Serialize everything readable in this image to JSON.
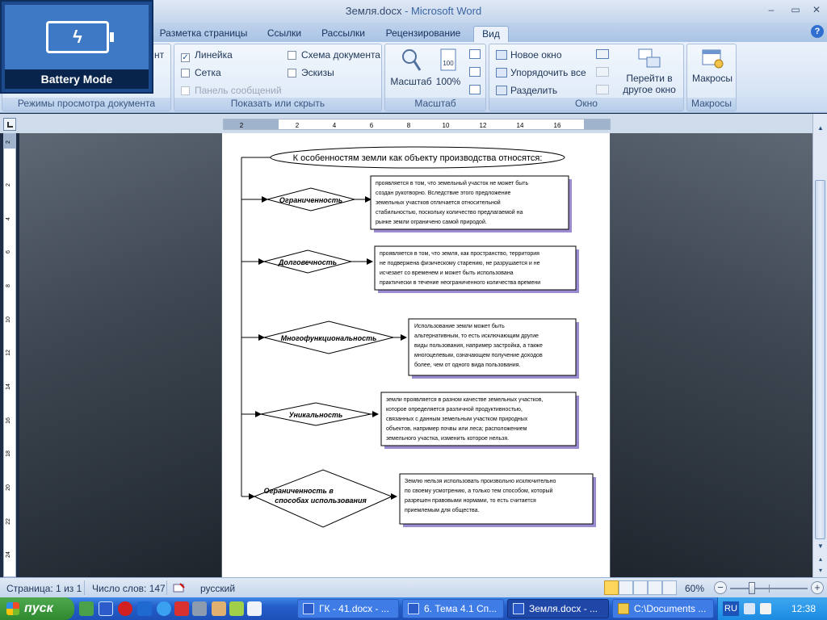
{
  "window": {
    "title_doc": "Земля.docx",
    "title_app": " - Microsoft Word",
    "minimize": "–",
    "restore": "▭",
    "close": "✕"
  },
  "battery_overlay": {
    "label": "Battery Mode"
  },
  "tabs": [
    {
      "label": "Разметка страницы"
    },
    {
      "label": "Ссылки"
    },
    {
      "label": "Рассылки"
    },
    {
      "label": "Рецензирование"
    },
    {
      "label": "Вид",
      "active": true
    }
  ],
  "help": "?",
  "ribbon": {
    "view_modes": {
      "label": "Режимы просмотра документа",
      "partial": "нт"
    },
    "show_hide": {
      "label": "Показать или скрыть",
      "ruler": "Линейка",
      "ruler_checked": "✓",
      "grid": "Сетка",
      "message_bar": "Панель сообщений",
      "doc_map": "Схема документа",
      "thumbnails": "Эскизы"
    },
    "zoom": {
      "label": "Масштаб",
      "zoom_btn": "Масштаб",
      "percent_btn": "100%"
    },
    "window": {
      "label": "Окно",
      "new_window": "Новое окно",
      "arrange_all": "Упорядочить все",
      "split": "Разделить",
      "switch_windows_line1": "Перейти в",
      "switch_windows_line2": "другое окно"
    },
    "macros": {
      "label": "Макросы",
      "macros_btn": "Макросы"
    }
  },
  "ruler": {
    "h_ticks": [
      "2",
      "2",
      "4",
      "6",
      "8",
      "10",
      "12",
      "14",
      "16"
    ],
    "v_ticks": [
      "2",
      "2",
      "4",
      "6",
      "8",
      "10",
      "12",
      "14",
      "16",
      "18",
      "20",
      "22",
      "24"
    ]
  },
  "document": {
    "header": "К особенностям земли как объекту производства относятся:",
    "items": [
      {
        "name": "Ограниченность",
        "description": [
          "проявляется в том, что земельный участок не может быть",
          "создан рукотворно. Вследствие этого предложение",
          "земельных участков отличается относительной",
          "стабильностью, поскольку количество предлагаемой на",
          "рынке земли ограничено самой природой."
        ]
      },
      {
        "name": "Долговечность",
        "description": [
          "проявляется в том, что земля, как пространство, территория",
          "не подвержена физическому старению, не разрушается и не",
          "исчезает со временем и может быть использована",
          "практически в течение неограниченного количества времени"
        ]
      },
      {
        "name": "Многофункциональность",
        "description": [
          "Использование земли может быть",
          "альтернативным, то есть исключающим другие",
          "виды пользования, например застройка, а также",
          "многоцелевым, означающем получение доходов",
          "более, чем от одного вида пользования."
        ]
      },
      {
        "name": "Уникальность",
        "description": [
          "земли проявляется в разном качестве земельных участков,",
          "которое определяется различной продуктивностью,",
          "связанных с данным земельным участком природных",
          "объектов, например почвы или леса; расположением",
          "земельного участка, изменить которое нельзя."
        ]
      },
      {
        "name_lines": [
          "Ограниченность в",
          "способах использования"
        ],
        "description": [
          "Землю нельзя использовать произвольно исключительно",
          "по своему усмотрению, а только тем способом, который",
          "разрешен правовыми нормами, то есть считается",
          "приемлемым для общества."
        ]
      }
    ]
  },
  "status_bar": {
    "page": "Страница: 1 из 1",
    "words": "Число слов: 147",
    "language": "русский",
    "zoom": "60%",
    "zoom_minus": "−",
    "zoom_plus": "+"
  },
  "taskbar": {
    "start": "пуск",
    "tasks": [
      {
        "label": "ГК - 41.docx - ..."
      },
      {
        "label": "6. Тема 4.1 Сп..."
      },
      {
        "label": "Земля.docx - ...",
        "active": true
      },
      {
        "label": "C:\\Documents ..."
      }
    ],
    "lang": "RU",
    "clock": "12:38"
  },
  "colors": {
    "ribbon_bg": "#dce8f6",
    "active_tab": "#eaf1fb",
    "doc_bg": "#56606c",
    "desc_shadow": "#9b8bd0",
    "taskbar": "#245ec9",
    "start": "#2f8a2f"
  }
}
